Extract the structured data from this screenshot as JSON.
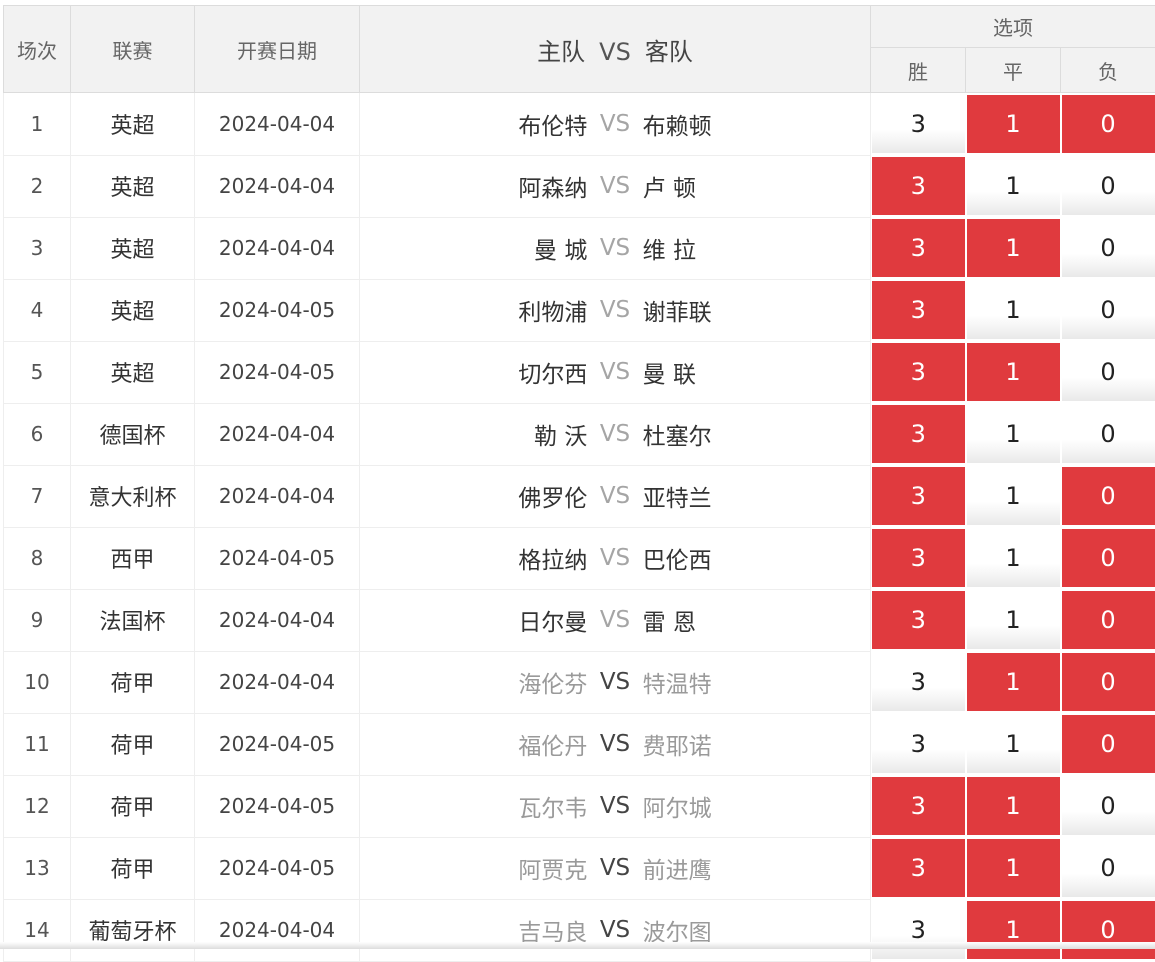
{
  "header": {
    "col_index": "场次",
    "col_league": "联赛",
    "col_date": "开赛日期",
    "col_home": "主队",
    "col_vs": "VS",
    "col_away": "客队",
    "col_options": "选项",
    "col_win": "胜",
    "col_draw": "平",
    "col_loss": "负"
  },
  "colors": {
    "selected": "#e03a3e",
    "dim_team": "#9a9a9a"
  },
  "rows": [
    {
      "no": "1",
      "league": "英超",
      "date": "2024-04-04",
      "home": "布伦特",
      "vs": "VS",
      "away": "布赖顿",
      "dim": false,
      "win": "3",
      "draw": "1",
      "loss": "0",
      "sel": [
        false,
        true,
        true
      ]
    },
    {
      "no": "2",
      "league": "英超",
      "date": "2024-04-04",
      "home": "阿森纳",
      "vs": "VS",
      "away": "卢 顿",
      "dim": false,
      "win": "3",
      "draw": "1",
      "loss": "0",
      "sel": [
        true,
        false,
        false
      ]
    },
    {
      "no": "3",
      "league": "英超",
      "date": "2024-04-04",
      "home": "曼 城",
      "vs": "VS",
      "away": "维 拉",
      "dim": false,
      "win": "3",
      "draw": "1",
      "loss": "0",
      "sel": [
        true,
        true,
        false
      ]
    },
    {
      "no": "4",
      "league": "英超",
      "date": "2024-04-05",
      "home": "利物浦",
      "vs": "VS",
      "away": "谢菲联",
      "dim": false,
      "win": "3",
      "draw": "1",
      "loss": "0",
      "sel": [
        true,
        false,
        false
      ]
    },
    {
      "no": "5",
      "league": "英超",
      "date": "2024-04-05",
      "home": "切尔西",
      "vs": "VS",
      "away": "曼 联",
      "dim": false,
      "win": "3",
      "draw": "1",
      "loss": "0",
      "sel": [
        true,
        true,
        false
      ]
    },
    {
      "no": "6",
      "league": "德国杯",
      "date": "2024-04-04",
      "home": "勒 沃",
      "vs": "VS",
      "away": "杜塞尔",
      "dim": false,
      "win": "3",
      "draw": "1",
      "loss": "0",
      "sel": [
        true,
        false,
        false
      ]
    },
    {
      "no": "7",
      "league": "意大利杯",
      "date": "2024-04-04",
      "home": "佛罗伦",
      "vs": "VS",
      "away": "亚特兰",
      "dim": false,
      "win": "3",
      "draw": "1",
      "loss": "0",
      "sel": [
        true,
        false,
        true
      ]
    },
    {
      "no": "8",
      "league": "西甲",
      "date": "2024-04-05",
      "home": "格拉纳",
      "vs": "VS",
      "away": "巴伦西",
      "dim": false,
      "win": "3",
      "draw": "1",
      "loss": "0",
      "sel": [
        true,
        false,
        true
      ]
    },
    {
      "no": "9",
      "league": "法国杯",
      "date": "2024-04-04",
      "home": "日尔曼",
      "vs": "VS",
      "away": "雷 恩",
      "dim": false,
      "win": "3",
      "draw": "1",
      "loss": "0",
      "sel": [
        true,
        false,
        true
      ]
    },
    {
      "no": "10",
      "league": "荷甲",
      "date": "2024-04-04",
      "home": "海伦芬",
      "vs": "VS",
      "away": "特温特",
      "dim": true,
      "win": "3",
      "draw": "1",
      "loss": "0",
      "sel": [
        false,
        true,
        true
      ]
    },
    {
      "no": "11",
      "league": "荷甲",
      "date": "2024-04-05",
      "home": "福伦丹",
      "vs": "VS",
      "away": "费耶诺",
      "dim": true,
      "win": "3",
      "draw": "1",
      "loss": "0",
      "sel": [
        false,
        false,
        true
      ]
    },
    {
      "no": "12",
      "league": "荷甲",
      "date": "2024-04-05",
      "home": "瓦尔韦",
      "vs": "VS",
      "away": "阿尔城",
      "dim": true,
      "win": "3",
      "draw": "1",
      "loss": "0",
      "sel": [
        true,
        true,
        false
      ]
    },
    {
      "no": "13",
      "league": "荷甲",
      "date": "2024-04-05",
      "home": "阿贾克",
      "vs": "VS",
      "away": "前进鹰",
      "dim": true,
      "win": "3",
      "draw": "1",
      "loss": "0",
      "sel": [
        true,
        true,
        false
      ]
    },
    {
      "no": "14",
      "league": "葡萄牙杯",
      "date": "2024-04-04",
      "home": "吉马良",
      "vs": "VS",
      "away": "波尔图",
      "dim": true,
      "win": "3",
      "draw": "1",
      "loss": "0",
      "sel": [
        false,
        true,
        true
      ]
    }
  ]
}
